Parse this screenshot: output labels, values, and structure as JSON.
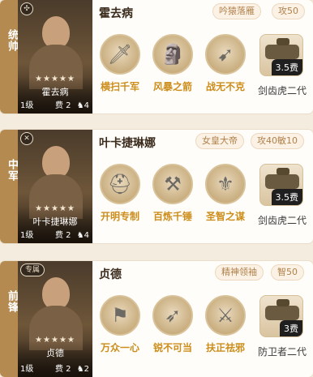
{
  "cards": [
    {
      "position": "统帅",
      "portrait": {
        "badge_icon": "circle-emblem-icon",
        "stars": "★★★★★",
        "name": "霍去病",
        "level": "1级",
        "cost": "费 2",
        "troops": "4"
      },
      "name": "霍去病",
      "tags": [
        "吟猿落雁",
        "攻50"
      ],
      "skills": [
        {
          "label": "横扫千军",
          "icon": "spear-rack-icon",
          "glyph": "🗡"
        },
        {
          "label": "风暴之箭",
          "icon": "statue-icon",
          "glyph": "🗿"
        },
        {
          "label": "战无不克",
          "icon": "arrow-burst-icon",
          "glyph": "➹"
        }
      ],
      "unit": {
        "cost": "3.5费",
        "name": "剑齿虎二代",
        "icon": "tank-icon"
      }
    },
    {
      "position": "中军",
      "portrait": {
        "badge_icon": "crossed-swords-icon",
        "stars": "★★★★★",
        "name": "叶卡捷琳娜",
        "level": "1级",
        "cost": "费 2",
        "troops": "4"
      },
      "name": "叶卡捷琳娜",
      "tags": [
        "女皇大帝",
        "攻40敏10"
      ],
      "skills": [
        {
          "label": "开明专制",
          "icon": "helmet-icon",
          "glyph": "⛑"
        },
        {
          "label": "百炼千锤",
          "icon": "anvil-icon",
          "glyph": "⚒"
        },
        {
          "label": "圣智之谋",
          "icon": "council-icon",
          "glyph": "⚜"
        }
      ],
      "unit": {
        "cost": "3.5费",
        "name": "剑齿虎二代",
        "icon": "tank-icon"
      }
    },
    {
      "position": "前锋",
      "portrait": {
        "badge_icon": "specialty-tag-icon",
        "badge_text": "专属",
        "stars": "★★★★★",
        "name": "贞德",
        "level": "1级",
        "cost": "费 2",
        "troops": "2"
      },
      "name": "贞德",
      "tags": [
        "精神领袖",
        "智50"
      ],
      "skills": [
        {
          "label": "万众一心",
          "icon": "banner-soldier-icon",
          "glyph": "⚑"
        },
        {
          "label": "锐不可当",
          "icon": "arrow-volley-icon",
          "glyph": "➶"
        },
        {
          "label": "扶正祛邪",
          "icon": "swordsman-icon",
          "glyph": "⚔"
        }
      ],
      "unit": {
        "cost": "3费",
        "name": "防卫者二代",
        "icon": "tank-icon"
      }
    }
  ]
}
